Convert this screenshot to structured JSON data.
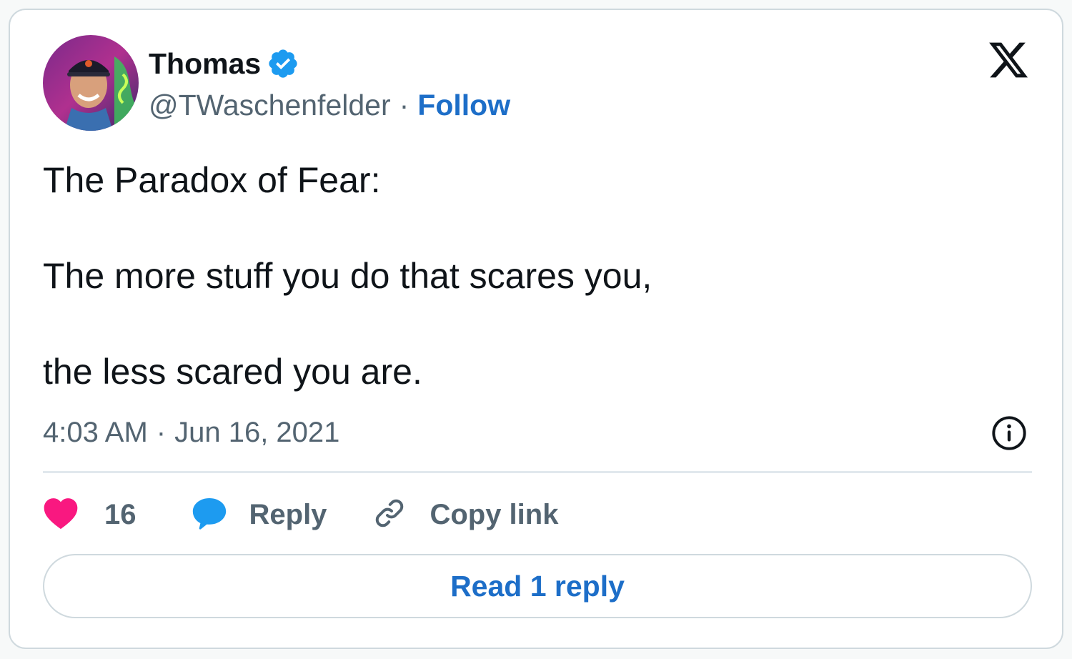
{
  "author": {
    "display_name": "Thomas",
    "handle": "@TWaschenfelder",
    "verified": true,
    "separator": "·",
    "follow_label": "Follow",
    "avatar_icon": "profile-photo-avatar"
  },
  "platform_logo_icon": "x-logo-icon",
  "tweet": {
    "lines": [
      "The Paradox of Fear:",
      "The more stuff you do that scares you,",
      "the less scared you are."
    ]
  },
  "meta": {
    "time": "4:03 AM",
    "separator": "·",
    "date": "Jun 16, 2021",
    "info_icon": "info-icon"
  },
  "actions": {
    "like_count": "16",
    "reply_label": "Reply",
    "copy_link_label": "Copy link"
  },
  "read_replies_label": "Read 1 reply",
  "colors": {
    "link_blue": "#1d6ec8",
    "verified_blue": "#1d9bf0",
    "like_pink": "#f91880",
    "reply_blue": "#1d9bf0",
    "secondary_text": "#536471",
    "border": "#cfd9de"
  }
}
